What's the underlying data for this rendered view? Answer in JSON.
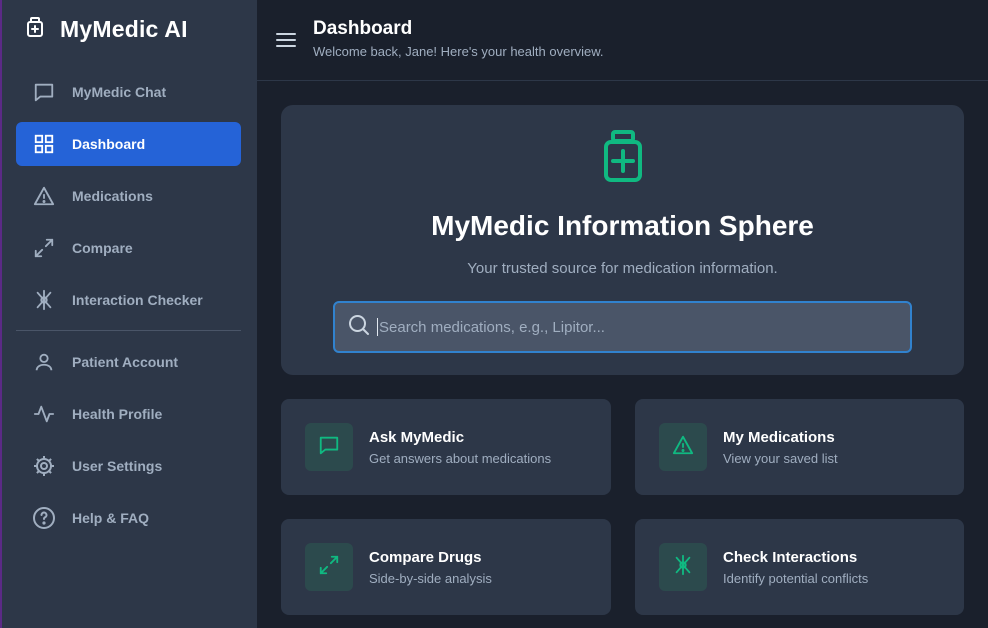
{
  "app": {
    "title": "MyMedic AI"
  },
  "sidebar": {
    "items": [
      {
        "label": "MyMedic Chat",
        "icon": "chat-bubble-icon",
        "active": false
      },
      {
        "label": "Dashboard",
        "icon": "grid-icon",
        "active": true
      },
      {
        "label": "Medications",
        "icon": "warning-triangle-icon",
        "active": false
      },
      {
        "label": "Compare",
        "icon": "expand-arrows-icon",
        "active": false
      },
      {
        "label": "Interaction Checker",
        "icon": "interaction-icon",
        "active": false
      }
    ],
    "secondary_items": [
      {
        "label": "Patient Account",
        "icon": "user-icon"
      },
      {
        "label": "Health Profile",
        "icon": "activity-icon"
      },
      {
        "label": "User Settings",
        "icon": "gear-icon"
      },
      {
        "label": "Help & FAQ",
        "icon": "help-circle-icon"
      }
    ]
  },
  "header": {
    "title": "Dashboard",
    "subtitle": "Welcome back, Jane! Here's your health overview."
  },
  "hero": {
    "icon": "medicine-bottle-icon",
    "title": "MyMedic Information Sphere",
    "subtitle": "Your trusted source for medication information.",
    "search": {
      "placeholder": "Search medications, e.g., Lipitor...",
      "value": ""
    }
  },
  "cards": [
    {
      "title": "Ask MyMedic",
      "desc": "Get answers about medications",
      "icon": "chat-bubble-icon"
    },
    {
      "title": "My Medications",
      "desc": "View your saved list",
      "icon": "warning-triangle-icon"
    },
    {
      "title": "Compare Drugs",
      "desc": "Side-by-side analysis",
      "icon": "expand-arrows-icon"
    },
    {
      "title": "Check Interactions",
      "desc": "Identify potential conflicts",
      "icon": "interaction-icon"
    }
  ],
  "colors": {
    "accent": "#2563d7",
    "brand_green": "#10b981",
    "sidebar_bg": "#2d3748",
    "page_bg": "#1a202c"
  }
}
